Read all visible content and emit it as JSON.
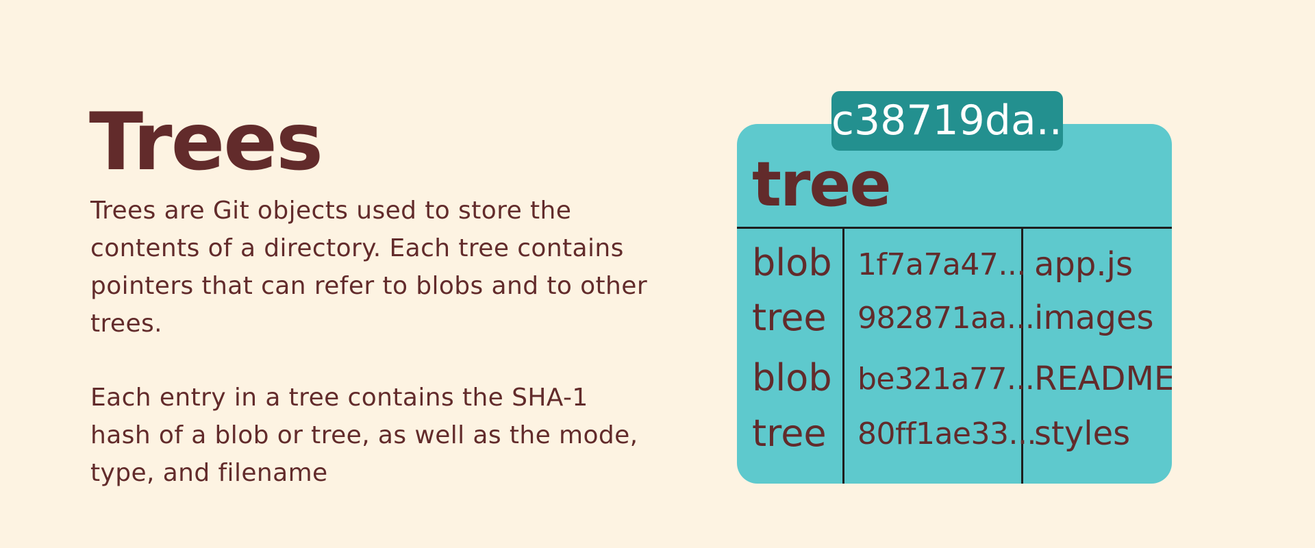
{
  "slide": {
    "title": "Trees",
    "paragraphs": [
      "Trees are Git objects used to store the contents of a directory.  Each tree contains pointers that can refer to blobs and to other trees.",
      "Each entry in a tree contains the SHA-1 hash of a blob or tree, as well as the mode, type, and filename"
    ]
  },
  "diagram": {
    "object_hash": "c38719da...",
    "object_type": "tree",
    "entries": [
      {
        "type": "blob",
        "hash": "1f7a7a47...",
        "name": "app.js"
      },
      {
        "type": "tree",
        "hash": "982871aa...",
        "name": "images"
      },
      {
        "type": "blob",
        "hash": "be321a77...",
        "name": "README"
      },
      {
        "type": "tree",
        "hash": "80ff1ae33...",
        "name": "styles"
      }
    ]
  },
  "colors": {
    "background": "#fdf3e2",
    "text": "#622b2b",
    "card": "#5ec9cd",
    "hash_tab": "#23908f",
    "divider": "#1e1e1e"
  }
}
